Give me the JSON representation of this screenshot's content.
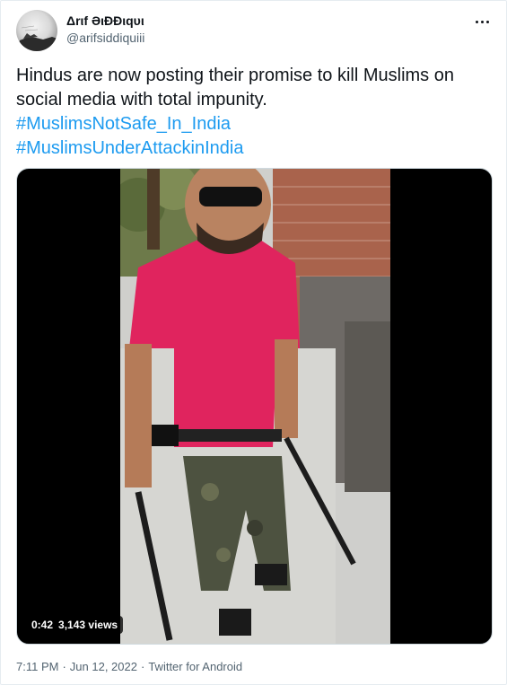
{
  "author": {
    "display_name": "Δrιf ƏιÐÐιqυι",
    "handle": "@arifsiddiquiii"
  },
  "tweet": {
    "text_lines": [
      "Hindus are now posting their promise to kill Muslims on",
      "social media with total impunity."
    ],
    "hashtags": [
      "#MuslimsNotSafe_In_India",
      "#MuslimsUnderAttackinIndia"
    ]
  },
  "video": {
    "duration": "0:42",
    "views": "3,143 views"
  },
  "meta": {
    "time": "7:11 PM",
    "separator": "·",
    "date": "Jun 12, 2022",
    "source": "Twitter for Android"
  },
  "colors": {
    "link": "#1d9bf0",
    "secondary_text": "#536471",
    "primary_text": "#0f1419",
    "shirt": "#e0245e"
  },
  "icons": [
    "more-options-icon"
  ]
}
